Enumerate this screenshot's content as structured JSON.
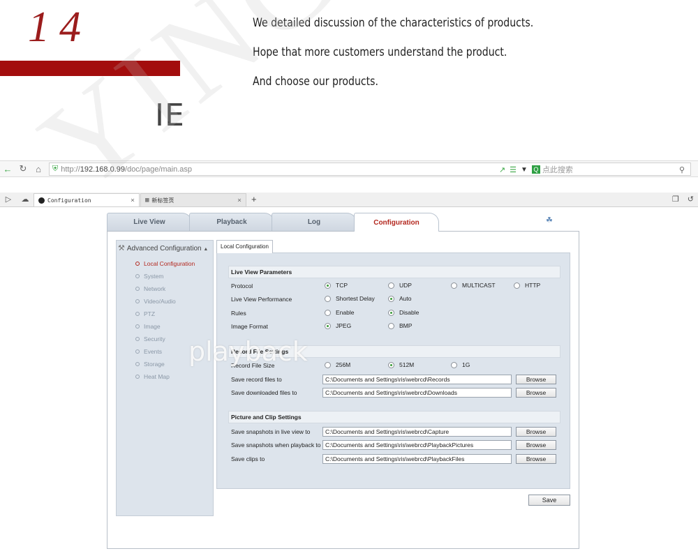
{
  "header": {
    "number": "14",
    "intro_lines": [
      "We detailed discussion of the characteristics of products.",
      "Hope that more customers understand the product.",
      "And choose our products."
    ],
    "browser_label": "IE"
  },
  "watermark": "YINCH",
  "overlay_text": "playback",
  "browser": {
    "url_scheme": "http://",
    "url_host": "192.168.0.99",
    "url_path": "/doc/page/main.asp",
    "search_placeholder": "点此搜索",
    "tabs": [
      {
        "title": "Configuration",
        "active": true
      },
      {
        "title": "新标签页",
        "active": false
      }
    ],
    "new_tab_label": "+"
  },
  "app": {
    "tabs": [
      {
        "label": "Live View",
        "active": false
      },
      {
        "label": "Playback",
        "active": false
      },
      {
        "label": "Log",
        "active": false
      },
      {
        "label": "Configuration",
        "active": true
      }
    ],
    "sidebar": {
      "heading": "Advanced Configuration",
      "items": [
        {
          "label": "Local Configuration",
          "current": true
        },
        {
          "label": "System",
          "current": false
        },
        {
          "label": "Network",
          "current": false
        },
        {
          "label": "Video/Audio",
          "current": false
        },
        {
          "label": "PTZ",
          "current": false
        },
        {
          "label": "Image",
          "current": false
        },
        {
          "label": "Security",
          "current": false
        },
        {
          "label": "Events",
          "current": false
        },
        {
          "label": "Storage",
          "current": false
        },
        {
          "label": "Heat Map",
          "current": false
        }
      ]
    },
    "panel_tab": "Local Configuration",
    "live_view": {
      "title": "Live View Parameters",
      "protocol": {
        "label": "Protocol",
        "options": [
          "TCP",
          "UDP",
          "MULTICAST",
          "HTTP"
        ],
        "selected": "TCP"
      },
      "performance": {
        "label": "Live View Performance",
        "options": [
          "Shortest Delay",
          "Auto"
        ],
        "selected": "Auto"
      },
      "rules": {
        "label": "Rules",
        "options": [
          "Enable",
          "Disable"
        ],
        "selected": "Disable"
      },
      "image_format": {
        "label": "Image Format",
        "options": [
          "JPEG",
          "BMP"
        ],
        "selected": "JPEG"
      }
    },
    "record": {
      "title": "Record File Settings",
      "file_size": {
        "label": "Record File Size",
        "options": [
          "256M",
          "512M",
          "1G"
        ],
        "selected": "512M"
      },
      "save_record": {
        "label": "Save record files to",
        "value": "C:\\Documents and Settings\\ris\\webrcd\\Records"
      },
      "save_downloaded": {
        "label": "Save downloaded files to",
        "value": "C:\\Documents and Settings\\ris\\webrcd\\Downloads"
      }
    },
    "picture": {
      "title": "Picture and Clip Settings",
      "snap_live": {
        "label": "Save snapshots in live view to",
        "value": "C:\\Documents and Settings\\ris\\webrcd\\Capture"
      },
      "snap_playback": {
        "label": "Save snapshots when playback to",
        "value": "C:\\Documents and Settings\\ris\\webrcd\\PlaybackPictures"
      },
      "clips": {
        "label": "Save clips to",
        "value": "C:\\Documents and Settings\\ris\\webrcd\\PlaybackFiles"
      }
    },
    "browse_label": "Browse",
    "save_label": "Save"
  },
  "colors": {
    "accent_red": "#a30d0d",
    "active_tab_text": "#b3271e",
    "panel_bg": "#dde4ec",
    "radio_dot": "#3a9a3a"
  }
}
